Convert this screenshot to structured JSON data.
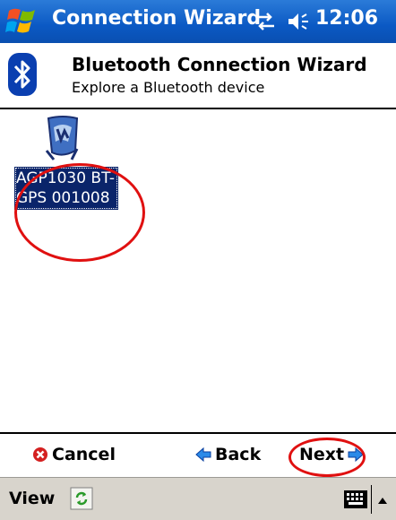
{
  "titlebar": {
    "title": "Connection Wizard",
    "time": "12:06",
    "icons": [
      "windows-start-icon",
      "connectivity-icon",
      "volume-icon"
    ]
  },
  "header": {
    "title": "Bluetooth Connection Wizard",
    "subtitle": "Explore a Bluetooth device",
    "icon": "bluetooth-icon"
  },
  "devices": [
    {
      "line1": "AGP1030 BT-",
      "line2": "GPS 001008",
      "icon": "gps-device-icon",
      "selected": true
    }
  ],
  "actions": {
    "cancel": "Cancel",
    "back": "Back",
    "next": "Next"
  },
  "menubar": {
    "view": "View",
    "icons": [
      "refresh-icon",
      "keyboard-icon",
      "sip-arrow-icon"
    ]
  },
  "colors": {
    "titlebar": "#0b59c4",
    "selection": "#0a246a",
    "annotation": "#e01010",
    "menubar": "#d8d4cc"
  }
}
